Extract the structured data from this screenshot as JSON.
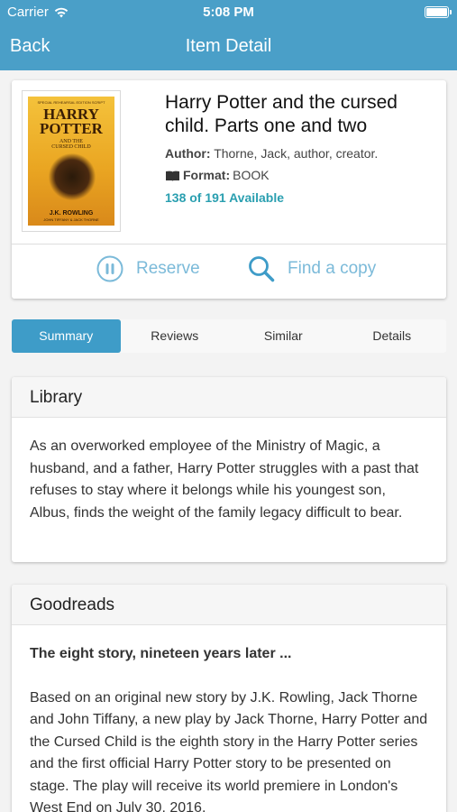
{
  "status": {
    "carrier": "Carrier",
    "time": "5:08 PM"
  },
  "nav": {
    "back_label": "Back",
    "title": "Item Detail"
  },
  "item": {
    "title": "Harry Potter and the cursed child. Parts one and two",
    "author_label": "Author:",
    "author": "Thorne, Jack, author, creator.",
    "format_label": "Format:",
    "format": "BOOK",
    "availability": "138 of 191 Available",
    "cover": {
      "top_line": "SPECIAL REHEARSAL EDITION SCRIPT",
      "title_line1": "HARRY",
      "title_line2": "POTTER",
      "subtitle_line1": "AND THE",
      "subtitle_line2": "CURSED CHILD",
      "author_line": "J.K. ROWLING",
      "coauthors_line": "JOHN TIFFANY & JACK THORNE"
    }
  },
  "actions": {
    "reserve_label": "Reserve",
    "find_label": "Find a copy"
  },
  "tabs": [
    {
      "label": "Summary",
      "active": true
    },
    {
      "label": "Reviews",
      "active": false
    },
    {
      "label": "Similar",
      "active": false
    },
    {
      "label": "Details",
      "active": false
    }
  ],
  "library": {
    "header": "Library",
    "text": "As an overworked employee of the Ministry of Magic, a husband, and a father, Harry Potter struggles with a past that refuses to stay where it belongs while his youngest son, Albus, finds the weight of the family legacy difficult to bear."
  },
  "goodreads": {
    "header": "Goodreads",
    "subheading": "The eight story, nineteen years later ...",
    "text": "Based on an original new story by J.K. Rowling, Jack Thorne and John Tiffany, a new play by Jack Thorne, Harry Potter and the Cursed Child is the eighth story in the Harry Potter series and the first official Harry Potter story to be presented on stage. The play will receive its world premiere in London's West End on July 30, 2016."
  },
  "colors": {
    "header_bg": "#4a9fc8",
    "accent": "#3e9cc8",
    "availability": "#2a9fb0",
    "action": "#7bbad9"
  },
  "icons": {
    "wifi": "wifi-icon",
    "battery": "battery-icon",
    "format": "book-icon",
    "reserve": "pause-circle-icon",
    "find": "search-icon"
  }
}
